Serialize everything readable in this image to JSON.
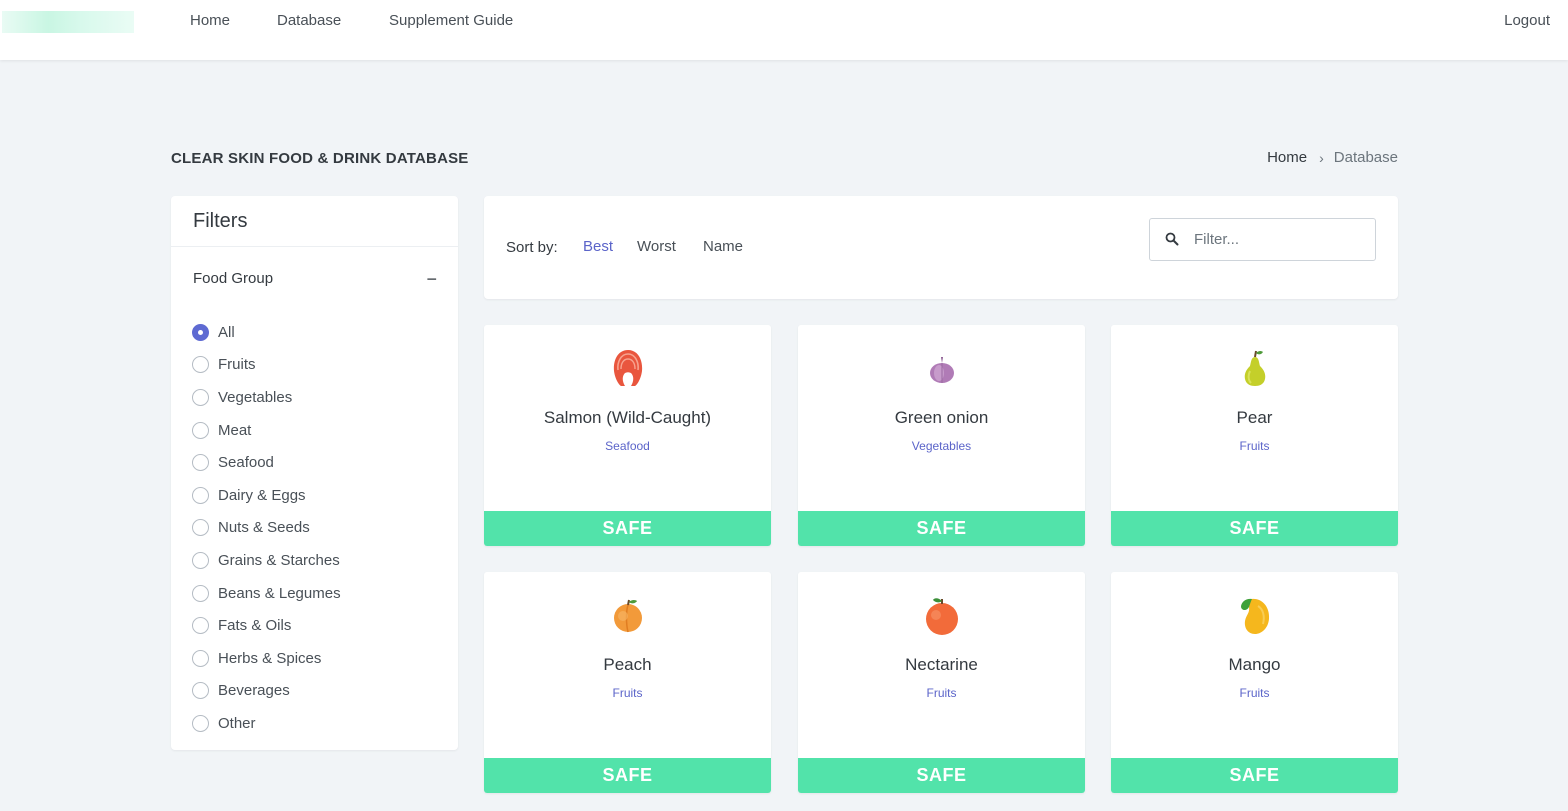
{
  "nav": {
    "home": "Home",
    "database": "Database",
    "guide": "Supplement Guide",
    "logout": "Logout"
  },
  "page": {
    "title": "CLEAR SKIN FOOD & DRINK DATABASE",
    "breadcrumb": {
      "home": "Home",
      "current": "Database"
    }
  },
  "filters": {
    "title": "Filters",
    "group_title": "Food Group",
    "collapse_symbol": "−",
    "options": [
      "All",
      "Fruits",
      "Vegetables",
      "Meat",
      "Seafood",
      "Dairy & Eggs",
      "Nuts & Seeds",
      "Grains & Starches",
      "Beans & Legumes",
      "Fats & Oils",
      "Herbs & Spices",
      "Beverages",
      "Other"
    ],
    "selected": "All"
  },
  "sort": {
    "label": "Sort by:",
    "best": "Best",
    "worst": "Worst",
    "name": "Name",
    "active": "Best",
    "filter_placeholder": "Filter..."
  },
  "cards": [
    {
      "name": "Salmon (Wild-Caught)",
      "group": "Seafood",
      "status": "SAFE",
      "icon": "salmon-icon"
    },
    {
      "name": "Green onion",
      "group": "Vegetables",
      "status": "SAFE",
      "icon": "onion-icon"
    },
    {
      "name": "Pear",
      "group": "Fruits",
      "status": "SAFE",
      "icon": "pear-icon"
    },
    {
      "name": "Peach",
      "group": "Fruits",
      "status": "SAFE",
      "icon": "peach-icon"
    },
    {
      "name": "Nectarine",
      "group": "Fruits",
      "status": "SAFE",
      "icon": "nectarine-icon"
    },
    {
      "name": "Mango",
      "group": "Fruits",
      "status": "SAFE",
      "icon": "mango-icon"
    }
  ],
  "colors": {
    "accent": "#5b64c9",
    "safe": "#52e3aa",
    "background": "#f1f4f7"
  }
}
